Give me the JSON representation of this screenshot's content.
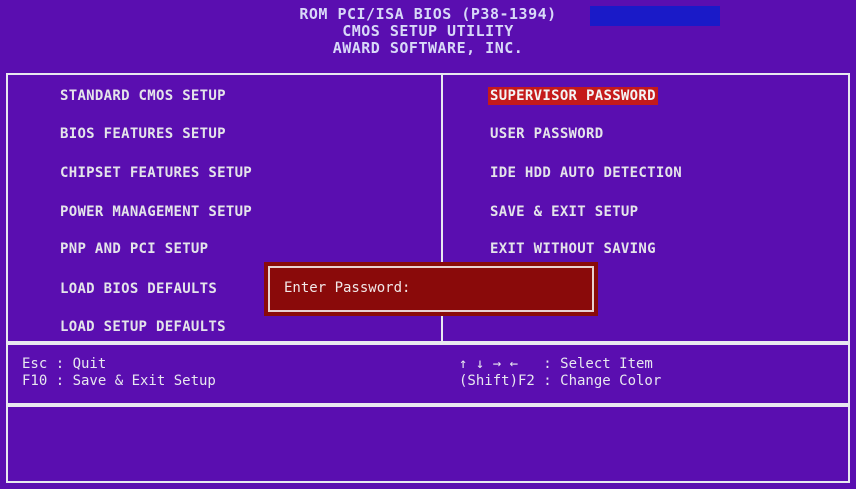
{
  "header": {
    "line1": "ROM PCI/ISA BIOS (P38-1394)",
    "line2": "CMOS SETUP UTILITY",
    "line3": "AWARD SOFTWARE, INC."
  },
  "menu": {
    "left": [
      "STANDARD CMOS SETUP",
      "BIOS FEATURES SETUP",
      "CHIPSET FEATURES SETUP",
      "POWER MANAGEMENT SETUP",
      "PNP AND PCI SETUP",
      "LOAD BIOS DEFAULTS",
      "LOAD SETUP DEFAULTS"
    ],
    "right": [
      "SUPERVISOR PASSWORD",
      "USER PASSWORD",
      "IDE HDD AUTO DETECTION",
      "SAVE & EXIT SETUP",
      "EXIT WITHOUT SAVING"
    ],
    "selected": "SUPERVISOR PASSWORD"
  },
  "help": {
    "left1": "Esc : Quit",
    "left2": "F10 : Save & Exit Setup",
    "right1": "↑ ↓ → ←   : Select Item",
    "right2": "(Shift)F2 : Change Color"
  },
  "dialog": {
    "label": "Enter Password:"
  },
  "colors": {
    "background": "#5a0eb0",
    "highlight": "#c41a1a",
    "dialog": "#8a0a0a",
    "text": "#e4e4ea"
  }
}
